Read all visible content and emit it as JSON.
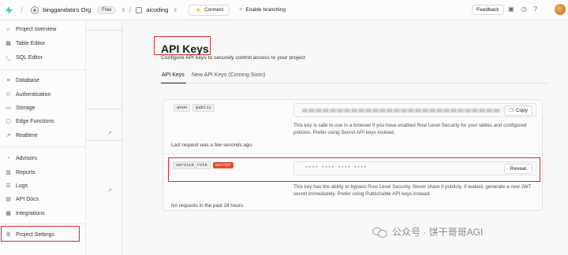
{
  "topbar": {
    "org_name": "binggandata's Org",
    "plan_badge": "Free",
    "project_name": "aicoding",
    "connect_label": "Connect",
    "enable_branching_label": "Enable branching",
    "feedback_label": "Feedback"
  },
  "sidebar": {
    "items": [
      {
        "label": "Project overview",
        "icon": "home-icon"
      },
      {
        "label": "Table Editor",
        "icon": "table-icon"
      },
      {
        "label": "SQL Editor",
        "icon": "terminal-icon"
      },
      {
        "label": "Database",
        "icon": "database-icon"
      },
      {
        "label": "Authentication",
        "icon": "users-icon"
      },
      {
        "label": "Storage",
        "icon": "archive-icon"
      },
      {
        "label": "Edge Functions",
        "icon": "code-icon"
      },
      {
        "label": "Realtime",
        "icon": "realtime-icon"
      },
      {
        "label": "Advisors",
        "icon": "lightbulb-icon"
      },
      {
        "label": "Reports",
        "icon": "chart-icon"
      },
      {
        "label": "Logs",
        "icon": "list-icon"
      },
      {
        "label": "API Docs",
        "icon": "document-icon"
      },
      {
        "label": "Integrations",
        "icon": "puzzle-icon"
      },
      {
        "label": "Project Settings",
        "icon": "gear-icon"
      }
    ]
  },
  "main": {
    "title": "API Keys",
    "description": "Configure API keys to securely control access to your project",
    "tabs": [
      {
        "label": "API Keys",
        "active": true
      },
      {
        "label": "New API Keys (Coming Soon)",
        "active": false
      }
    ],
    "anon_key": {
      "tags": [
        "anon",
        "public"
      ],
      "copy_label": "Copy",
      "hint": "This key is safe to use in a browser if you have enabled Row Level Security for your tables and configured policies. Prefer using Secret API keys instead.",
      "last_request": "Last request was a few seconds ago."
    },
    "service_key": {
      "tag": "service_role",
      "secret_badge": "secret",
      "masked_value": "**** **** **** ****",
      "reveal_label": "Reveal",
      "hint": "This key has the ability to bypass Row Level Security. Never share it publicly. If leaked, generate a new JWT secret immediately. Prefer using Publishable API keys instead.",
      "last_request": "No requests in the past 24 hours."
    }
  },
  "watermark": {
    "text": "公众号 · 饼干哥哥AGI"
  },
  "colors": {
    "brand_green": "#3ecf8e",
    "annotation_red": "#d42a2a",
    "secret_badge": "#e54d2e"
  }
}
